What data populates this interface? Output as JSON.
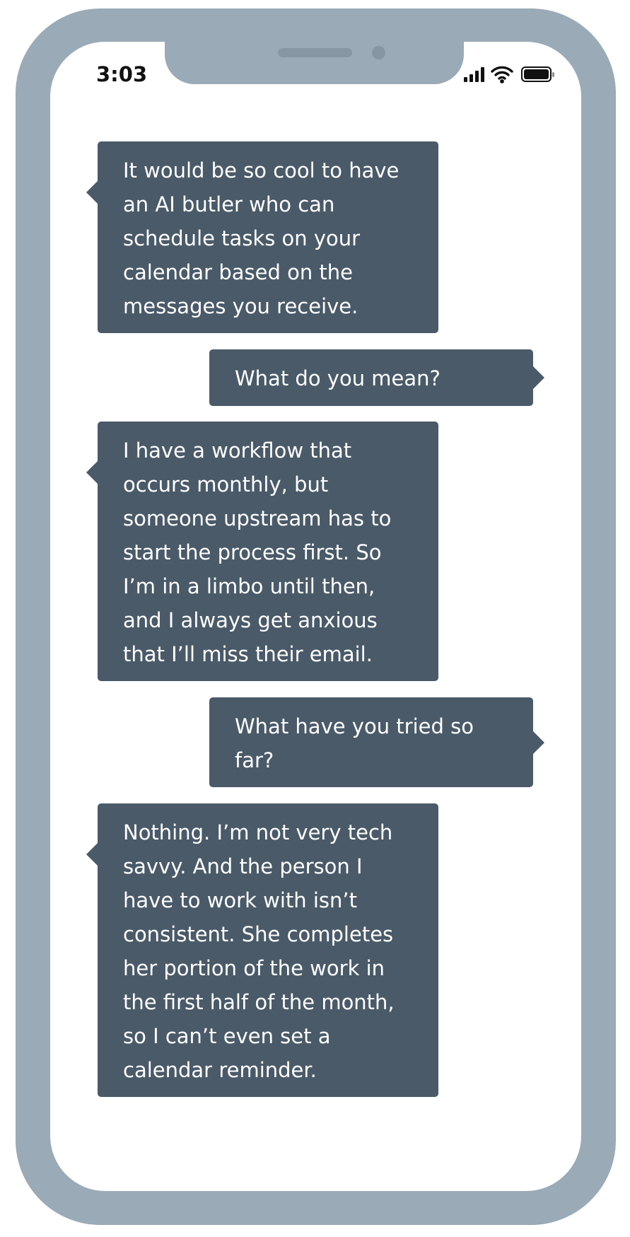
{
  "status_bar": {
    "time": "3:03",
    "icons": [
      "signal-icon",
      "wifi-icon",
      "battery-icon"
    ]
  },
  "messages": [
    {
      "side": "received",
      "text": "It would be so cool to have an AI butler who can schedule tasks on your calendar based on the messages you receive."
    },
    {
      "side": "sent",
      "text": "What do you mean?"
    },
    {
      "side": "received",
      "text": "I have a workflow that occurs monthly, but someone upstream has to start the process first. So I’m in a limbo until then, and I always get anxious that I’ll miss their email."
    },
    {
      "side": "sent",
      "text": "What have you tried so far?"
    },
    {
      "side": "received",
      "text": "Nothing. I’m not very tech savvy. And the person I have to work with isn’t consistent. She completes her portion of the work in the first half of the month, so I can’t even set a calendar reminder."
    }
  ],
  "colors": {
    "frame": "#9aaab7",
    "bubble": "#4a5a69",
    "bubble_text": "#ffffff",
    "screen": "#ffffff"
  }
}
